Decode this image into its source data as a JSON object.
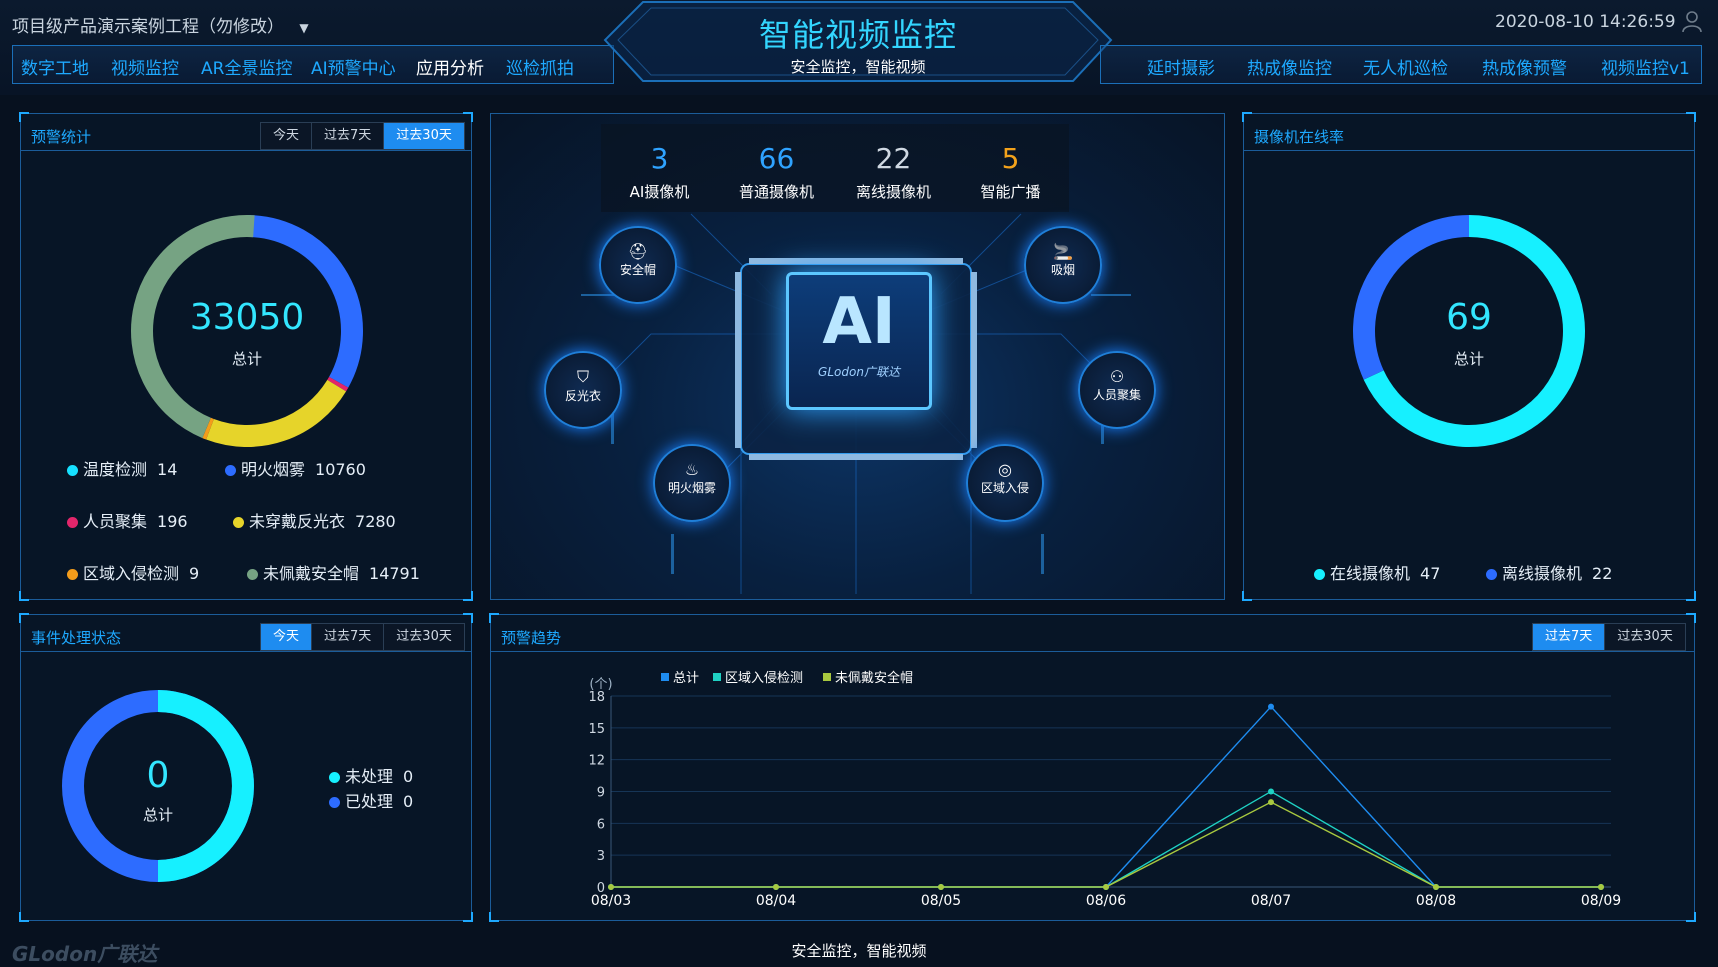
{
  "header": {
    "project": "项目级产品演示案例工程（勿修改）",
    "datetime": "2020-08-10 14:26:59",
    "title": "智能视频监控",
    "subtitle": "安全监控，智能视频",
    "nav_left": [
      "数字工地",
      "视频监控",
      "AR全景监控",
      "AI预警中心",
      "应用分析",
      "巡检抓拍"
    ],
    "nav_left_active": "应用分析",
    "nav_right": [
      "延时摄影",
      "热成像监控",
      "无人机巡检",
      "热成像预警",
      "视频监控v1"
    ]
  },
  "alert_stats": {
    "title": "预警统计",
    "tabs": [
      "今天",
      "过去7天",
      "过去30天"
    ],
    "active_tab": "过去30天",
    "total": "33050",
    "total_label": "总计",
    "items": [
      {
        "name": "温度检测",
        "value": "14",
        "color": "#16e0ff"
      },
      {
        "name": "明火烟雾",
        "value": "10760",
        "color": "#2d6cff"
      },
      {
        "name": "人员聚集",
        "value": "196",
        "color": "#e3266b"
      },
      {
        "name": "未穿戴反光衣",
        "value": "7280",
        "color": "#e6d42a"
      },
      {
        "name": "区域入侵检测",
        "value": "9",
        "color": "#f39c1b"
      },
      {
        "name": "未佩戴安全帽",
        "value": "14791",
        "color": "#76a383"
      }
    ]
  },
  "center": {
    "stats": [
      {
        "value": "3",
        "label": "AI摄像机",
        "color": "#2fa3ff"
      },
      {
        "value": "66",
        "label": "普通摄像机",
        "color": "#2fa3ff"
      },
      {
        "value": "22",
        "label": "离线摄像机",
        "color": "#cfd8e2"
      },
      {
        "value": "5",
        "label": "智能广播",
        "color": "#f3a21b"
      }
    ],
    "chip_text": "AI",
    "chip_brand": "GLodon广联达",
    "nodes": [
      {
        "label": "安全帽",
        "icon": "helmet-icon"
      },
      {
        "label": "吸烟",
        "icon": "cigarette-icon"
      },
      {
        "label": "反光衣",
        "icon": "vest-icon"
      },
      {
        "label": "人员聚集",
        "icon": "crowd-icon"
      },
      {
        "label": "明火烟雾",
        "icon": "fire-icon"
      },
      {
        "label": "区域入侵",
        "icon": "intrusion-icon"
      }
    ]
  },
  "camera_online": {
    "title": "摄像机在线率",
    "total": "69",
    "total_label": "总计",
    "items": [
      {
        "name": "在线摄像机",
        "value": "47",
        "color": "#16f0ff"
      },
      {
        "name": "离线摄像机",
        "value": "22",
        "color": "#2d6cff"
      }
    ]
  },
  "event_status": {
    "title": "事件处理状态",
    "tabs": [
      "今天",
      "过去7天",
      "过去30天"
    ],
    "active_tab": "今天",
    "total": "0",
    "total_label": "总计",
    "items": [
      {
        "name": "未处理",
        "value": "0",
        "color": "#16f0ff"
      },
      {
        "name": "已处理",
        "value": "0",
        "color": "#2d6cff"
      }
    ]
  },
  "trend": {
    "title": "预警趋势",
    "tabs": [
      "过去7天",
      "过去30天"
    ],
    "active_tab": "过去7天",
    "unit_label": "(个)"
  },
  "chart_data": {
    "type": "line",
    "title": "预警趋势",
    "ylabel": "(个)",
    "x": [
      "08/03",
      "08/04",
      "08/05",
      "08/06",
      "08/07",
      "08/08",
      "08/09"
    ],
    "ylim": [
      0,
      18
    ],
    "yticks": [
      0,
      3,
      6,
      9,
      12,
      15,
      18
    ],
    "series": [
      {
        "name": "总计",
        "values": [
          0,
          0,
          0,
          0,
          17,
          0,
          0
        ],
        "color": "#1e8cf0"
      },
      {
        "name": "区域入侵检测",
        "values": [
          0,
          0,
          0,
          0,
          9,
          0,
          0
        ],
        "color": "#1fd1c3"
      },
      {
        "name": "未佩戴安全帽",
        "values": [
          0,
          0,
          0,
          0,
          8,
          0,
          0
        ],
        "color": "#a8c83f"
      }
    ],
    "legend_position": "top",
    "grid": true
  },
  "footer": {
    "subtitle": "安全监控，智能视频",
    "brand": "GLodon广联达"
  }
}
